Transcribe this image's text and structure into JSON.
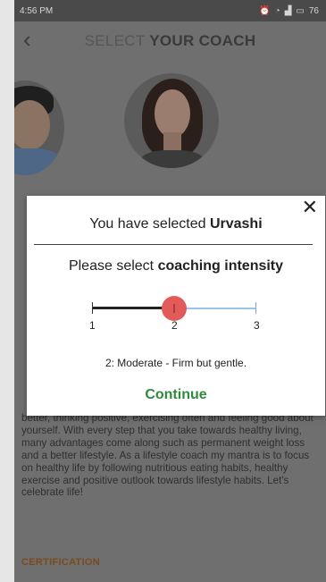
{
  "status_bar": {
    "time": "4:56 PM",
    "battery": "76"
  },
  "header": {
    "title_light": "SELECT ",
    "title_bold": "YOUR COACH"
  },
  "bio_text": "better, thinking positive, exercising often and feeling good about yourself. With every step that you take towards healthy living, many advantages come along such as permanent weight loss and a better lifestyle. As a lifestyle coach my mantra is to focus on healthy life by following nutritious eating habits, healthy exercise and positive outlook towards lifestyle habits. Let's celebrate life!",
  "certification_label": "CERTIFICATION",
  "modal": {
    "selected_prefix": "You have selected ",
    "coach_name": "Urvashi",
    "intensity_prefix": "Please select ",
    "intensity_bold": "coaching intensity",
    "slider": {
      "min": 1,
      "max": 3,
      "value": 2,
      "tick_labels": [
        "1",
        "2",
        "3"
      ]
    },
    "level_description": "2: Moderate - Firm but gentle.",
    "continue_label": "Continue",
    "close_symbol": "✕"
  },
  "colors": {
    "continue": "#2e8b3d",
    "slider_thumb": "#e25a5a",
    "slider_track": "#9ec1e6"
  }
}
